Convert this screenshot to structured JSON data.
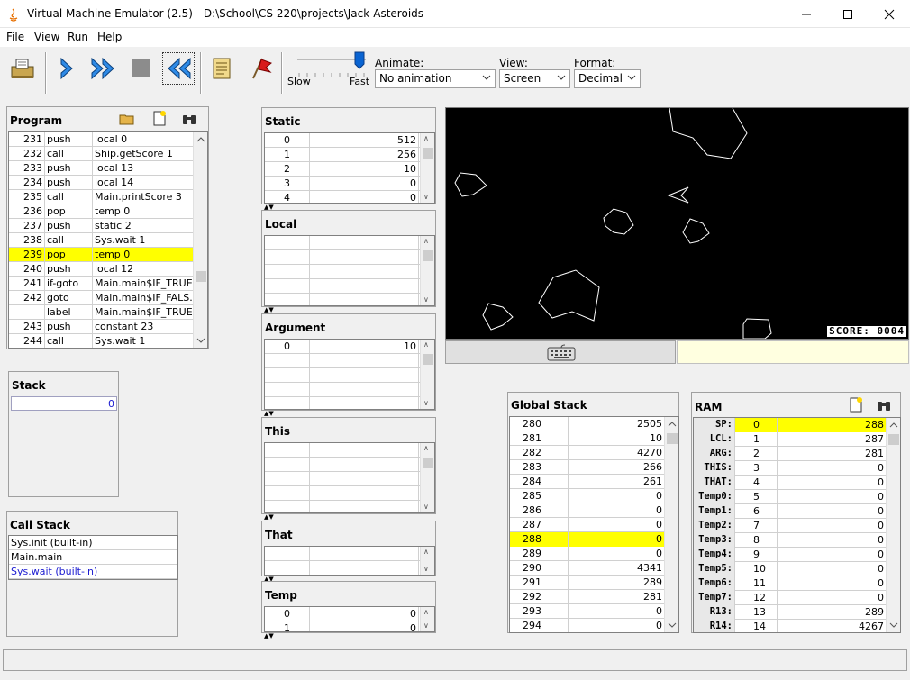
{
  "window": {
    "title": "Virtual Machine Emulator (2.5) - D:\\School\\CS 220\\projects\\Jack-Asteroids"
  },
  "menu": [
    "File",
    "View",
    "Run",
    "Help"
  ],
  "toolbar": {
    "icons": [
      "load-program-icon",
      "single-step-icon",
      "fast-forward-icon",
      "stop-icon",
      "rewind-icon",
      "script-icon",
      "breakpoint-flag-icon"
    ],
    "speed": {
      "slow_label": "Slow",
      "fast_label": "Fast",
      "value": 0.95
    },
    "animate": {
      "label": "Animate:",
      "value": "No animation"
    },
    "view": {
      "label": "View:",
      "value": "Screen"
    },
    "format": {
      "label": "Format:",
      "value": "Decimal"
    }
  },
  "program": {
    "title": "Program",
    "rows": [
      {
        "n": "231",
        "cmd": "push",
        "arg": "local 0"
      },
      {
        "n": "232",
        "cmd": "call",
        "arg": "Ship.getScore 1"
      },
      {
        "n": "233",
        "cmd": "push",
        "arg": "local 13"
      },
      {
        "n": "234",
        "cmd": "push",
        "arg": "local 14"
      },
      {
        "n": "235",
        "cmd": "call",
        "arg": "Main.printScore 3"
      },
      {
        "n": "236",
        "cmd": "pop",
        "arg": "temp 0"
      },
      {
        "n": "237",
        "cmd": "push",
        "arg": "static 2"
      },
      {
        "n": "238",
        "cmd": "call",
        "arg": "Sys.wait 1"
      },
      {
        "n": "239",
        "cmd": "pop",
        "arg": "temp 0"
      },
      {
        "n": "240",
        "cmd": "push",
        "arg": "local 12"
      },
      {
        "n": "241",
        "cmd": "if-goto",
        "arg": "Main.main$IF_TRUE..."
      },
      {
        "n": "242",
        "cmd": "goto",
        "arg": "Main.main$IF_FALS..."
      },
      {
        "n": "",
        "cmd": "label",
        "arg": "Main.main$IF_TRUE..."
      },
      {
        "n": "243",
        "cmd": "push",
        "arg": "constant 23"
      },
      {
        "n": "244",
        "cmd": "call",
        "arg": "Sys.wait 1"
      }
    ],
    "highlight_row": "239"
  },
  "stack": {
    "title": "Stack",
    "rows": [
      "0"
    ]
  },
  "call_stack": {
    "title": "Call Stack",
    "rows": [
      "Sys.init (built-in)",
      "Main.main",
      "Sys.wait (built-in)"
    ]
  },
  "static": {
    "title": "Static",
    "rows": [
      [
        "0",
        "512"
      ],
      [
        "1",
        "256"
      ],
      [
        "2",
        "10"
      ],
      [
        "3",
        "0"
      ],
      [
        "4",
        "0"
      ]
    ]
  },
  "local": {
    "title": "Local",
    "rows": [
      [
        "",
        ""
      ],
      [
        "",
        ""
      ],
      [
        "",
        ""
      ],
      [
        "",
        ""
      ],
      [
        "",
        ""
      ]
    ]
  },
  "argument": {
    "title": "Argument",
    "rows": [
      [
        "0",
        "10"
      ],
      [
        "",
        ""
      ],
      [
        "",
        ""
      ],
      [
        "",
        ""
      ],
      [
        "",
        ""
      ]
    ]
  },
  "this_seg": {
    "title": "This",
    "rows": [
      [
        "",
        ""
      ],
      [
        "",
        ""
      ],
      [
        "",
        ""
      ],
      [
        "",
        ""
      ],
      [
        "",
        ""
      ]
    ]
  },
  "that_seg": {
    "title": "That",
    "rows": [
      [
        "",
        ""
      ],
      [
        "",
        ""
      ]
    ]
  },
  "temp": {
    "title": "Temp",
    "rows": [
      [
        "0",
        "0"
      ],
      [
        "1",
        "0"
      ]
    ]
  },
  "screen": {
    "score_text": "SCORE: 0004"
  },
  "global_stack": {
    "title": "Global Stack",
    "rows": [
      [
        "280",
        "2505"
      ],
      [
        "281",
        "10"
      ],
      [
        "282",
        "4270"
      ],
      [
        "283",
        "266"
      ],
      [
        "284",
        "261"
      ],
      [
        "285",
        "0"
      ],
      [
        "286",
        "0"
      ],
      [
        "287",
        "0"
      ],
      [
        "288",
        "0"
      ],
      [
        "289",
        "0"
      ],
      [
        "290",
        "4341"
      ],
      [
        "291",
        "289"
      ],
      [
        "292",
        "281"
      ],
      [
        "293",
        "0"
      ],
      [
        "294",
        "0"
      ]
    ],
    "highlight_row": "288"
  },
  "ram": {
    "title": "RAM",
    "rows": [
      [
        "SP:",
        "0",
        "288"
      ],
      [
        "LCL:",
        "1",
        "287"
      ],
      [
        "ARG:",
        "2",
        "281"
      ],
      [
        "THIS:",
        "3",
        "0"
      ],
      [
        "THAT:",
        "4",
        "0"
      ],
      [
        "Temp0:",
        "5",
        "0"
      ],
      [
        "Temp1:",
        "6",
        "0"
      ],
      [
        "Temp2:",
        "7",
        "0"
      ],
      [
        "Temp3:",
        "8",
        "0"
      ],
      [
        "Temp4:",
        "9",
        "0"
      ],
      [
        "Temp5:",
        "10",
        "0"
      ],
      [
        "Temp6:",
        "11",
        "0"
      ],
      [
        "Temp7:",
        "12",
        "0"
      ],
      [
        "R13:",
        "13",
        "289"
      ],
      [
        "R14:",
        "14",
        "4267"
      ]
    ]
  }
}
